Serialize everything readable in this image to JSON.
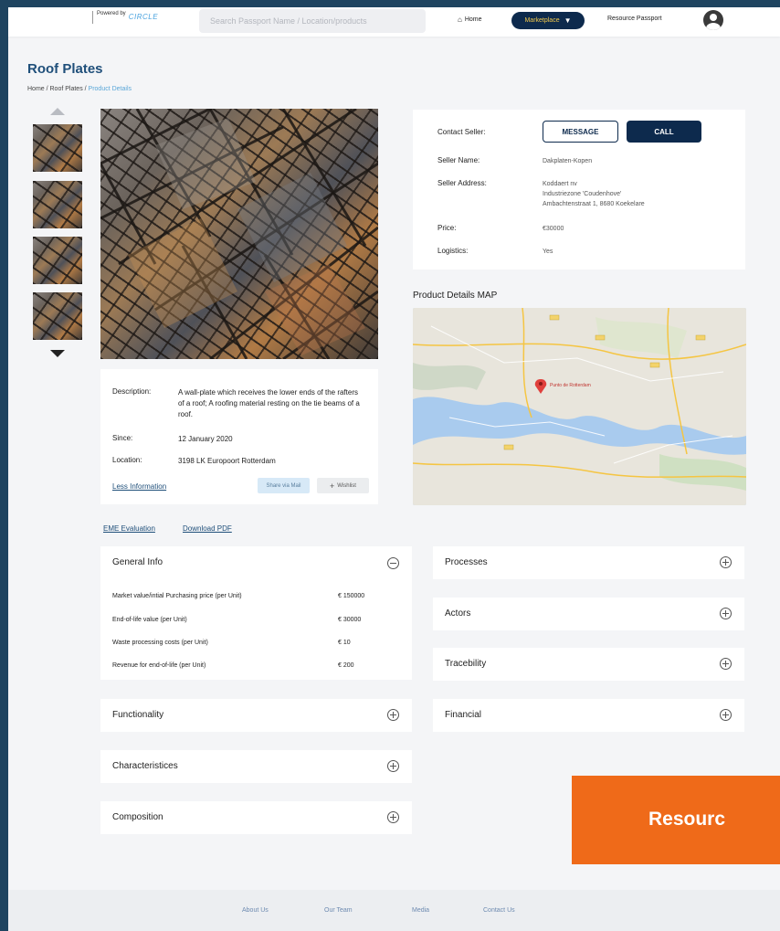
{
  "header": {
    "powered_by": "Powered by",
    "logo_text": "CIRCLE",
    "search_placeholder": "Search Passport Name / Location/products",
    "nav_home": "Home",
    "nav_marketplace": "Marketplace",
    "nav_resource_passport": "Resource Passport"
  },
  "page": {
    "title": "Roof Plates",
    "breadcrumb_prefix": "Home / Roof Plates / ",
    "breadcrumb_current": "Product Details"
  },
  "product": {
    "description_label": "Description:",
    "description": "A wall-plate which receives the lower ends of the rafters of a roof; A roofing material resting on the tie beams of a roof.",
    "since_label": "Since:",
    "since": "12 January 2020",
    "location_label": "Location:",
    "location": "3198 LK Europoort Rotterdam",
    "less_info": "Less Information",
    "share_label": "Share via Mail",
    "wishlist_label": "Wishlist"
  },
  "seller": {
    "contact_label": "Contact Seller:",
    "message_btn": "MESSAGE",
    "call_btn": "CALL",
    "name_label": "Seller Name:",
    "name": "Dakplaten-Kopen",
    "address_label": "Seller Address:",
    "address_line1": "Koddaert nv",
    "address_line2": "Industriezone 'Coudenhove'",
    "address_line3": "Ambachtenstraat 1, 8680 Koekelare",
    "price_label": "Price:",
    "price": "€30000",
    "logistics_label": "Logistics:",
    "logistics": "Yes"
  },
  "map": {
    "title": "Product Details MAP",
    "pin_label": "Punto de Rotterdam"
  },
  "links": {
    "eme": "EME Evaluation",
    "pdf": "Download PDF"
  },
  "general_info": {
    "title": "General Info",
    "rows": [
      {
        "label": "Market value/intial Purchasing price (per Unit)",
        "value": "€ 150000"
      },
      {
        "label": "End-of-life value (per Unit)",
        "value": "€ 30000"
      },
      {
        "label": "Waste processing costs (per Unit)",
        "value": "€ 10"
      },
      {
        "label": "Revenue for end-of-life (per Unit)",
        "value": "€ 200"
      }
    ]
  },
  "sections_left": [
    "Functionality",
    "Characteristices",
    "Composition"
  ],
  "sections_right": [
    "Processes",
    "Actors",
    "Tracebility",
    "Financial"
  ],
  "banner": {
    "text": "Resourc"
  },
  "footer": {
    "about": "About Us",
    "team": "Our Team",
    "media": "Media",
    "contact": "Contact Us"
  },
  "colors": {
    "navy": "#0d2a4d",
    "title_blue": "#1f4f7a",
    "accent_orange": "#ef6a19",
    "page_bg": "#f4f5f7"
  }
}
